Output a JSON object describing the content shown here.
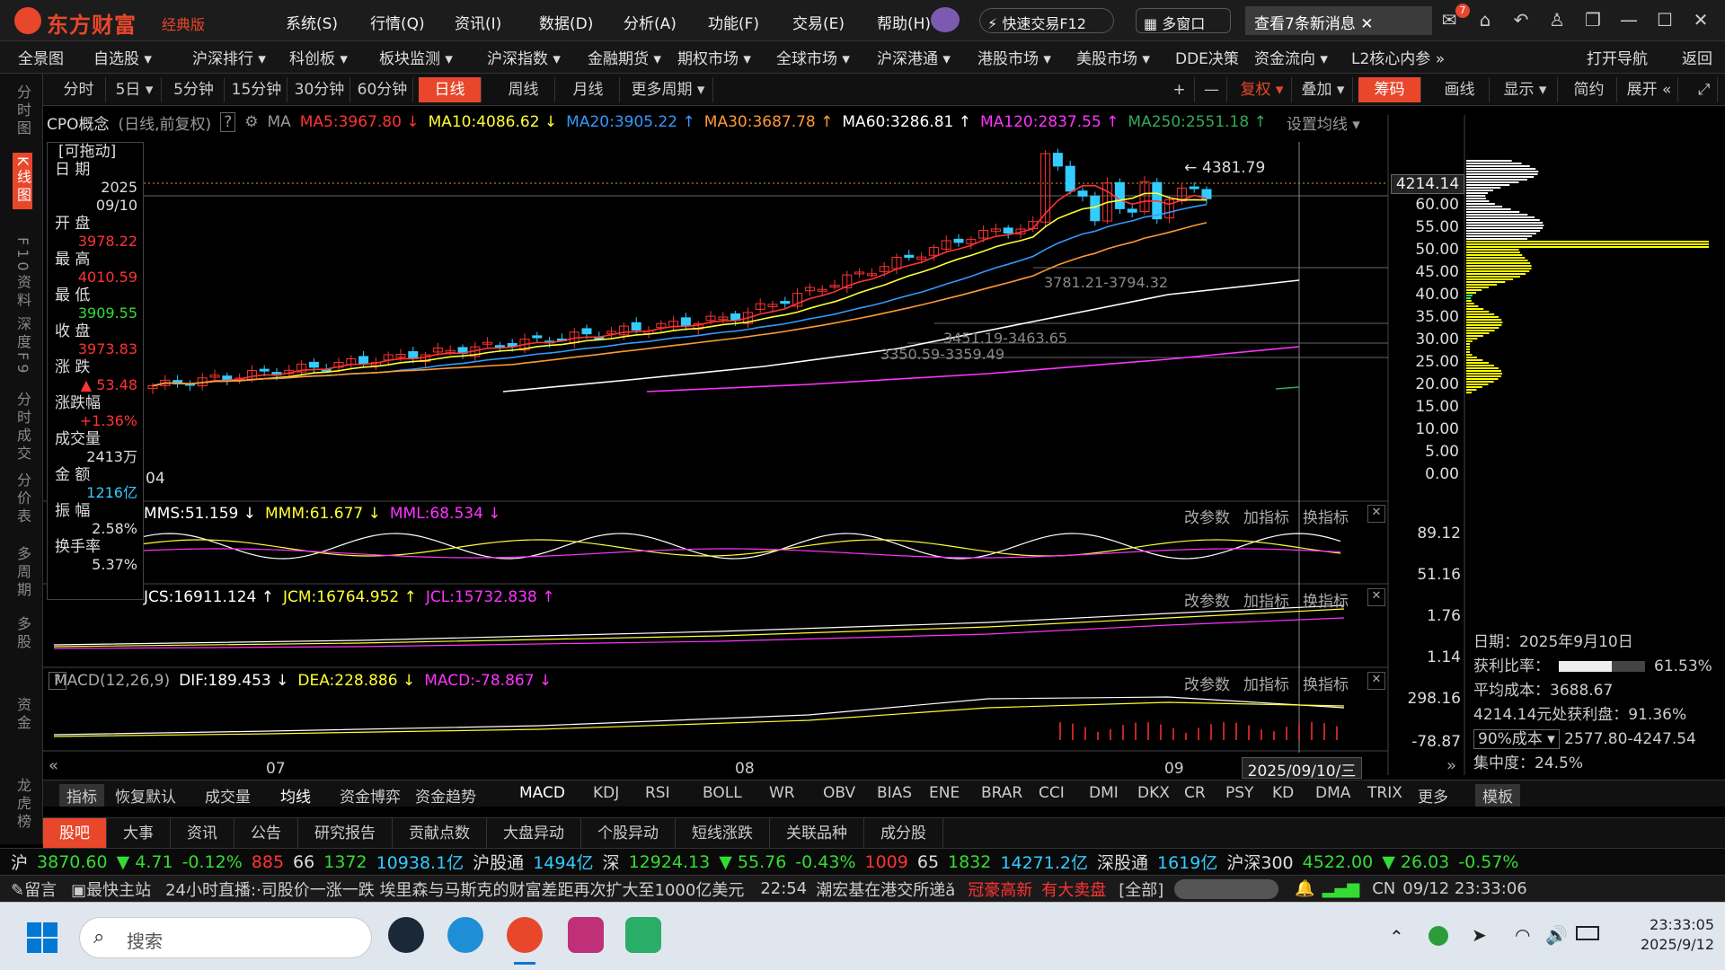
{
  "app": {
    "name": "东方财富",
    "edition": "经典版"
  },
  "menu": [
    "系统(S)",
    "行情(Q)",
    "资讯(I)",
    "数据(D)",
    "分析(A)",
    "功能(F)",
    "交易(E)",
    "帮助(H)"
  ],
  "titlebar": {
    "quick_trade": "快速交易F12",
    "multi_window": "多窗口",
    "new_msg": "查看7条新消息",
    "msg_badge": "7"
  },
  "nav": [
    "全景图",
    "自选股 ▾",
    "沪深排行 ▾",
    "科创板 ▾",
    "板块监测 ▾",
    "沪深指数 ▾",
    "金融期货 ▾",
    "期权市场 ▾",
    "全球市场 ▾",
    "沪深港通 ▾",
    "港股市场 ▾",
    "美股市场 ▾",
    "DDE决策",
    "资金流向 ▾",
    "L2核心内参 »",
    "打开导航",
    "返回"
  ],
  "left_strip": [
    {
      "label": "分时图",
      "active": false
    },
    {
      "label": "K线图",
      "active": true
    },
    {
      "label": "F10资料",
      "active": false
    },
    {
      "label": "深度F9",
      "active": false
    },
    {
      "label": "分时成交",
      "active": false
    },
    {
      "label": "分价表",
      "active": false
    },
    {
      "label": "多周期",
      "active": false
    },
    {
      "label": "多股",
      "active": false
    },
    {
      "label": "资金",
      "active": false
    },
    {
      "label": "龙虎榜",
      "active": false
    }
  ],
  "toolbar": {
    "periods": [
      "分时",
      "5日 ▾",
      "5分钟",
      "15分钟",
      "30分钟",
      "60分钟",
      "日线",
      "周线",
      "月线",
      "更多周期 ▾"
    ],
    "selected": "日线",
    "right": [
      "+",
      "—",
      "复权 ▾",
      "叠加 ▾",
      "筹码",
      "画线",
      "显示 ▾",
      "简约",
      "展开 «"
    ]
  },
  "ma_line": {
    "name": "CPO概念",
    "mode": "(日线,前复权)",
    "help": "?",
    "ma_label": "MA",
    "items": [
      {
        "text": "MA5:3967.80 ↓",
        "color": "#ff3333"
      },
      {
        "text": "MA10:4086.62 ↓",
        "color": "#ffff33"
      },
      {
        "text": "MA20:3905.22 ↑",
        "color": "#3399ff"
      },
      {
        "text": "MA30:3687.78 ↑",
        "color": "#ff9933"
      },
      {
        "text": "MA60:3286.81 ↑",
        "color": "#ffffff"
      },
      {
        "text": "MA120:2837.55 ↑",
        "color": "#ff33ff"
      },
      {
        "text": "MA250:2551.18 ↑",
        "color": "#33aa55"
      }
    ],
    "setting": "设置均线 ▾"
  },
  "info_panel": {
    "draggable": "[可拖动]",
    "rows": [
      {
        "label": "日 期",
        "value": "2025\n09/10",
        "color": "#ddd"
      },
      {
        "label": "开 盘",
        "value": "3978.22",
        "color": "#ff3333"
      },
      {
        "label": "最 高",
        "value": "4010.59",
        "color": "#ff3333"
      },
      {
        "label": "最 低",
        "value": "3909.55",
        "color": "#33dd33"
      },
      {
        "label": "收 盘",
        "value": "3973.83",
        "color": "#ff3333"
      },
      {
        "label": "涨 跌",
        "value": "▲ 53.48",
        "color": "#ff3333"
      },
      {
        "label": "涨跌幅",
        "value": "+1.36%",
        "color": "#ff3333"
      },
      {
        "label": "成交量",
        "value": "2413万",
        "color": "#ddd"
      },
      {
        "label": "金 额",
        "value": "1216亿",
        "color": "#33ccff"
      },
      {
        "label": "振 幅",
        "value": "2.58%",
        "color": "#ddd"
      },
      {
        "label": "换手率",
        "value": "5.37%",
        "color": "#ddd"
      }
    ]
  },
  "main_chart": {
    "price_label": "4214.14",
    "high_label": "4381.79",
    "low_label": "04",
    "range_labels": [
      "3781.21-3794.32",
      "3451.19-3463.65",
      "3350.59-3359.49"
    ],
    "y_ticks": [
      "60.00",
      "55.00",
      "50.00",
      "45.00",
      "40.00",
      "35.00",
      "30.00",
      "25.00",
      "20.00",
      "15.00",
      "10.00",
      "5.00",
      "0.00"
    ]
  },
  "panel1": {
    "header": [
      {
        "text": "MMS:51.159 ↓",
        "color": "#ffffff"
      },
      {
        "text": "MMM:61.677 ↓",
        "color": "#ffff33"
      },
      {
        "text": "MML:68.534 ↓",
        "color": "#ff33ff"
      }
    ],
    "ticks": [
      "89.12",
      "51.16"
    ]
  },
  "panel2": {
    "header": [
      {
        "text": "JCS:16911.124 ↑",
        "color": "#ffffff"
      },
      {
        "text": "JCM:16764.952 ↑",
        "color": "#ffff33"
      },
      {
        "text": "JCL:15732.838 ↑",
        "color": "#ff33ff"
      }
    ],
    "ticks": [
      "1.76",
      "1.14"
    ]
  },
  "panel3": {
    "header": [
      {
        "text": "MACD(12,26,9)",
        "color": "#aaaaaa"
      },
      {
        "text": "DIF:189.453 ↓",
        "color": "#ffffff"
      },
      {
        "text": "DEA:228.886 ↓",
        "color": "#ffff33"
      },
      {
        "text": "MACD:-78.867 ↓",
        "color": "#ff33ff"
      }
    ],
    "ticks": [
      "298.16",
      "-78.87"
    ]
  },
  "panel_buttons": [
    "改参数",
    "加指标",
    "换指标"
  ],
  "x_axis": {
    "labels": [
      "07",
      "08",
      "09"
    ],
    "current": "2025/09/10/三"
  },
  "chip": {
    "date": "日期：2025年9月10日",
    "profit_label": "获利比率：",
    "profit": "61.53%",
    "avg_cost": "平均成本：3688.67",
    "at_price": "4214.14元处获利盘：91.36%",
    "cost_select": "90%成本 ▾",
    "cost_range": "2577.80-4247.54",
    "concentration": "集中度：24.5%"
  },
  "ind_tabs": [
    "指标",
    "恢复默认",
    "成交量",
    "均线",
    "资金博弈",
    "资金趋势",
    "MACD",
    "KDJ",
    "RSI",
    "BOLL",
    "WR",
    "OBV",
    "BIAS",
    "ENE",
    "BRAR",
    "CCI",
    "DMI",
    "DKX",
    "CR",
    "PSY",
    "KD",
    "DMA",
    "TRIX",
    "更多",
    "模板"
  ],
  "bottom_tabs": [
    "股吧",
    "大事",
    "资讯",
    "公告",
    "研究报告",
    "贡献点数",
    "大盘异动",
    "个股异动",
    "短线涨跌",
    "关联品种",
    "成分股"
  ],
  "ticker": {
    "sh": "沪",
    "sh_val": "3870.60",
    "sh_chg": "▼ 4.71",
    "sh_pct": "-0.12%",
    "sh_up": "885",
    "sh_flat": "66",
    "sh_down": "1372",
    "sh_amt": "10938.1亿",
    "hgt": "沪股通",
    "hgt_val": "1494亿",
    "sz": "深",
    "sz_val": "12924.13",
    "sz_chg": "▼ 55.76",
    "sz_pct": "-0.43%",
    "sz_up": "1009",
    "sz_flat": "65",
    "sz_down": "1832",
    "sz_amt": "14271.2亿",
    "sgt": "深股通",
    "sgt_val": "1619亿",
    "hs300": "沪深300",
    "hs_val": "4522.00",
    "hs_chg": "▼ 26.03",
    "hs_pct": "-0.57%"
  },
  "status": {
    "msg": "留言",
    "station": "最快主站",
    "news": "24小时直播:·司股价一涨一跌 埃里森与马斯克的财富差距再次扩大至1000亿美元",
    "time": "22:54",
    "news2": "潮宏基在港交所递ǎ",
    "tag1": "冠豪高新",
    "tag2": "有大卖盘",
    "all": "[全部]",
    "lang": "CN",
    "datetime": "09/12 23:33:06"
  },
  "taskbar": {
    "search": "搜索",
    "time": "23:33:05",
    "date": "2025/9/12"
  },
  "colors": {
    "up": "#ff3333",
    "down": "#33ccff",
    "accent": "#e8472b"
  }
}
